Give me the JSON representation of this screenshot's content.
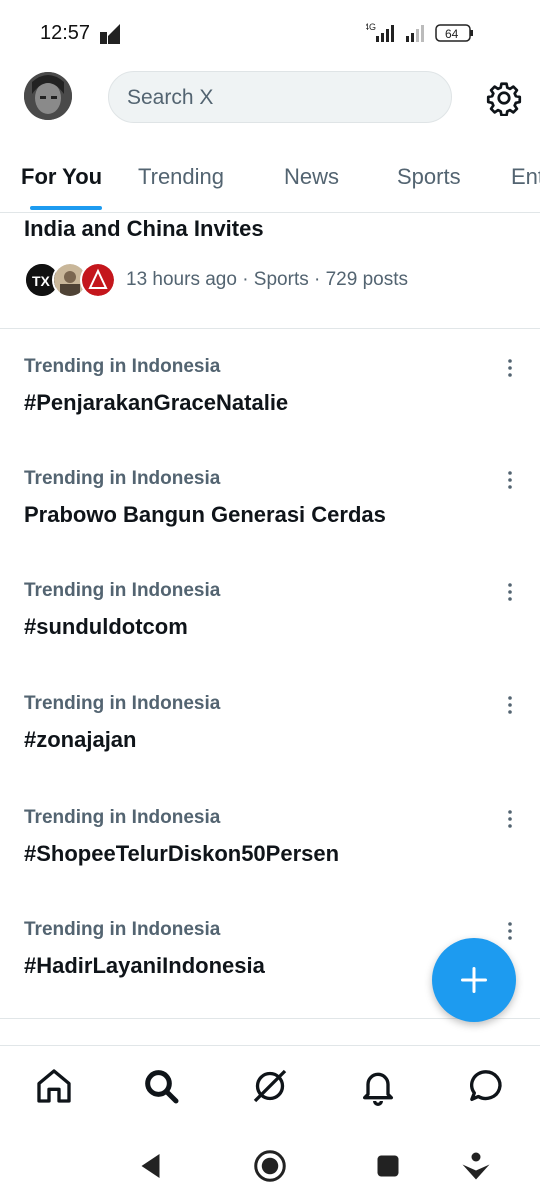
{
  "status_bar": {
    "time": "12:57",
    "network": "4G",
    "battery": "64"
  },
  "header": {
    "search_placeholder": "Search X",
    "avatar_icon": "profile-avatar",
    "settings_icon": "gear-icon"
  },
  "tabs": [
    {
      "label": "For You",
      "active": true
    },
    {
      "label": "Trending",
      "active": false
    },
    {
      "label": "News",
      "active": false
    },
    {
      "label": "Sports",
      "active": false
    },
    {
      "label": "Ent",
      "active": false
    }
  ],
  "top_item": {
    "headline": "India and China Invites",
    "meta": "13 hours ago · Sports · 729 posts"
  },
  "trends": [
    {
      "context": "Trending in Indonesia",
      "name": "#PenjarakanGraceNatalie"
    },
    {
      "context": "Trending in Indonesia",
      "name": "Prabowo Bangun Generasi Cerdas"
    },
    {
      "context": "Trending in Indonesia",
      "name": "#sunduldotcom"
    },
    {
      "context": "Trending in Indonesia",
      "name": "#zonajajan"
    },
    {
      "context": "Trending in Indonesia",
      "name": "#ShopeeTelurDiskon50Persen"
    },
    {
      "context": "Trending in Indonesia",
      "name": "#HadirLayaniIndonesia"
    }
  ],
  "bottom_nav": [
    "home-icon",
    "search-icon",
    "grok-icon",
    "notifications-icon",
    "messages-icon"
  ],
  "system_nav": [
    "back-icon",
    "home-circle-icon",
    "recents-icon",
    "assistant-icon"
  ],
  "colors": {
    "accent": "#1d9bf0",
    "text": "#0f1419",
    "secondary": "#536471"
  }
}
